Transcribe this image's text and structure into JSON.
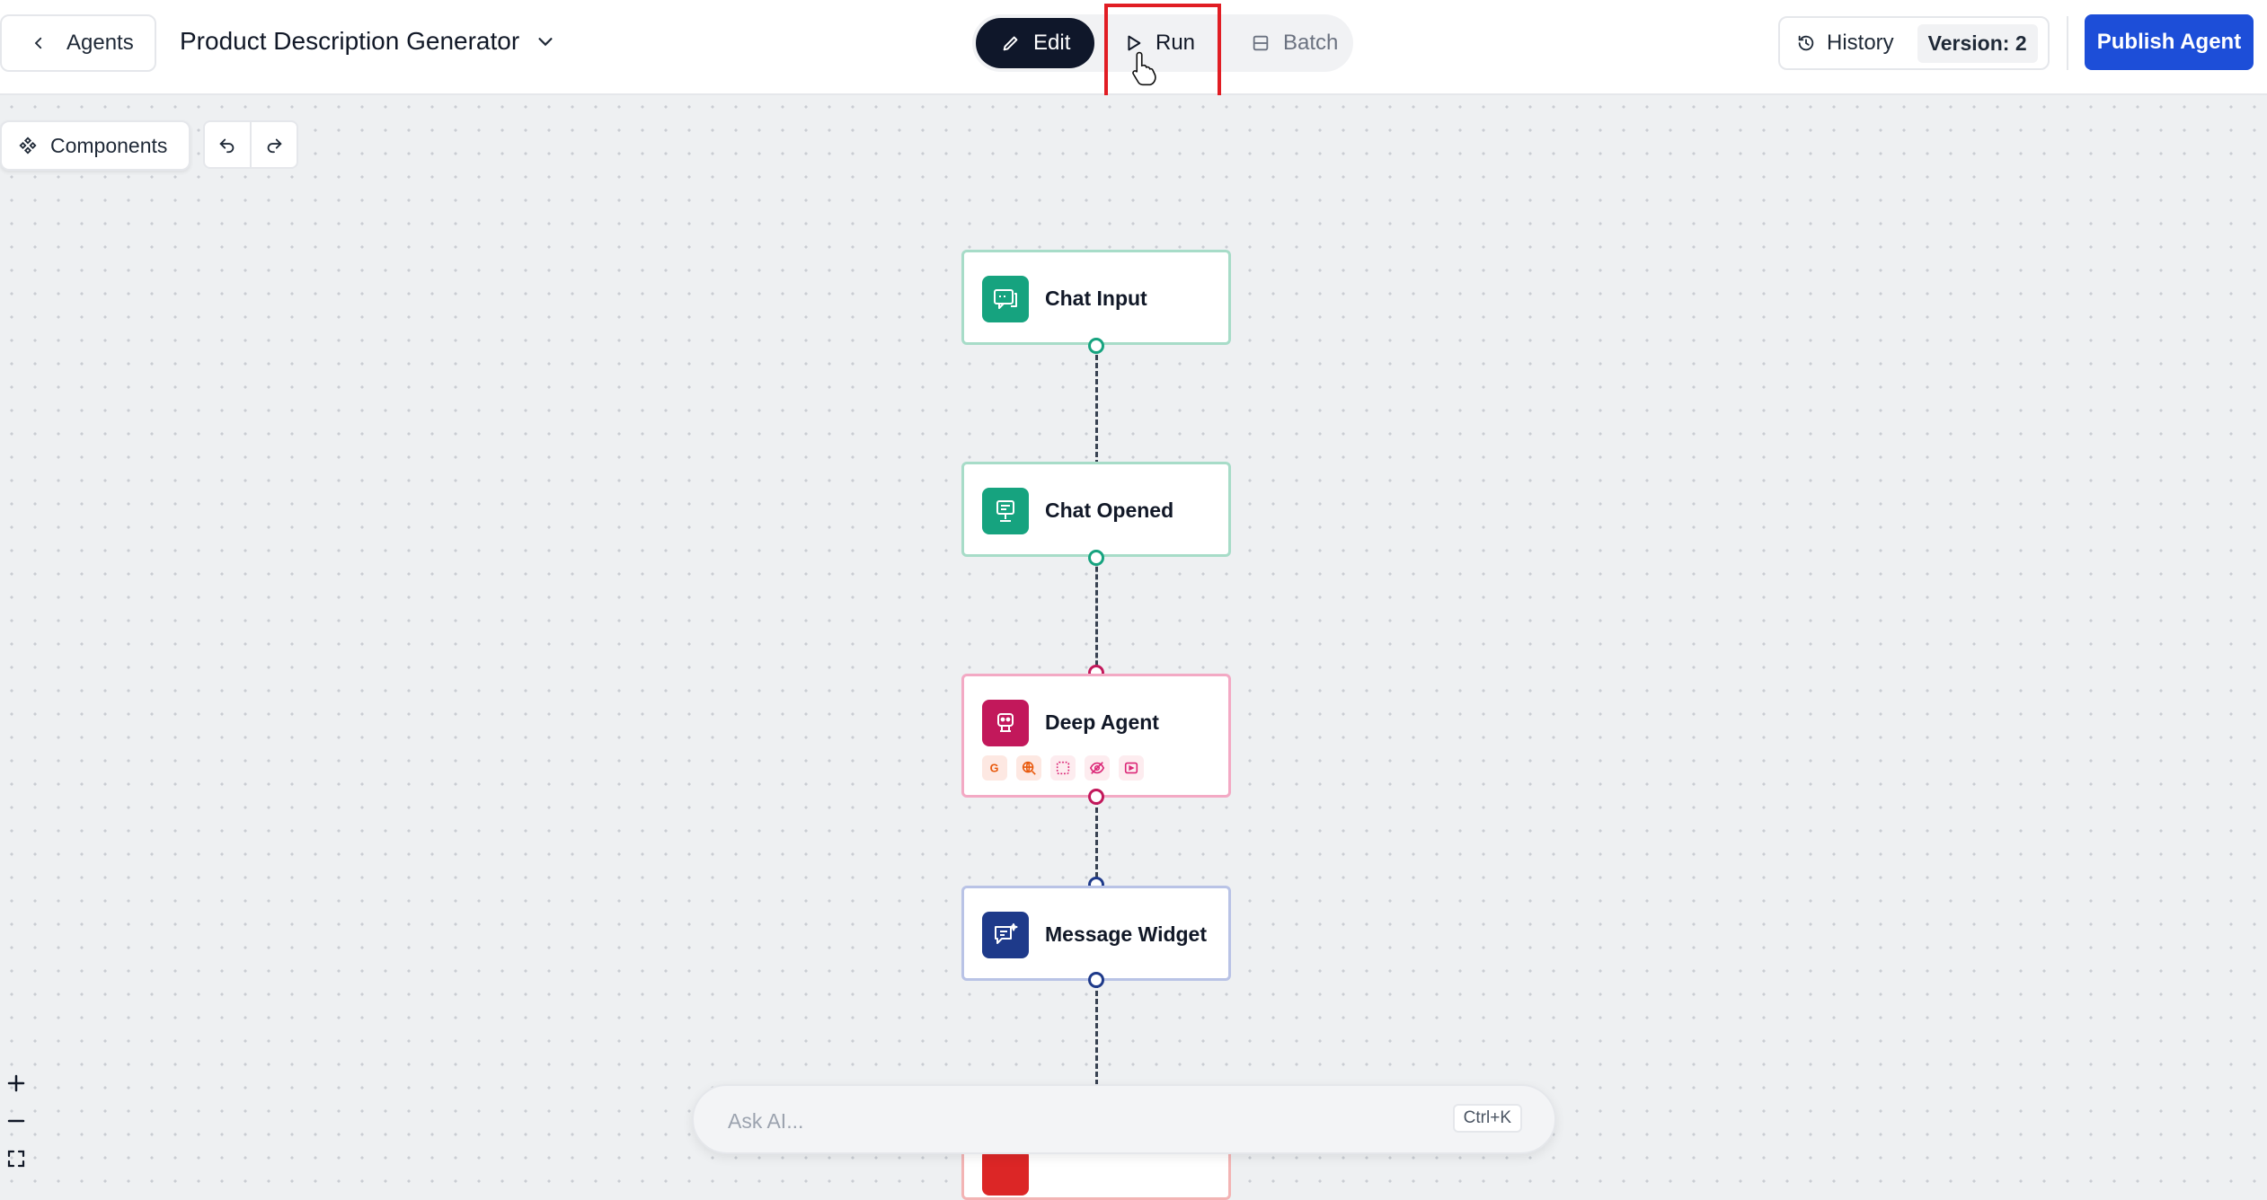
{
  "header": {
    "back_label": "Agents",
    "agent_title": "Product Description Generator",
    "modes": {
      "edit": "Edit",
      "run": "Run",
      "batch": "Batch"
    },
    "history_label": "History",
    "version_label": "Version: 2",
    "publish_label": "Publish Agent"
  },
  "toolbar": {
    "components_label": "Components"
  },
  "nodes": [
    {
      "label": "Chat Input",
      "color": "#16a37f"
    },
    {
      "label": "Chat Opened",
      "color": "#16a37f"
    },
    {
      "label": "Deep Agent",
      "color": "#c2185b",
      "tool_icons": [
        "google-icon",
        "globe-search-icon",
        "select-box-icon",
        "eye-off-icon",
        "video-icon"
      ]
    },
    {
      "label": "Message Widget",
      "color": "#1e3a8a"
    },
    {
      "label": "",
      "color": "#dc2626"
    }
  ],
  "ask_ai": {
    "placeholder": "Ask AI...",
    "shortcut": "Ctrl+K"
  },
  "colors": {
    "highlight": "#e11d24",
    "publish_button": "#1d4ed8",
    "edit_active": "#0f172a"
  }
}
